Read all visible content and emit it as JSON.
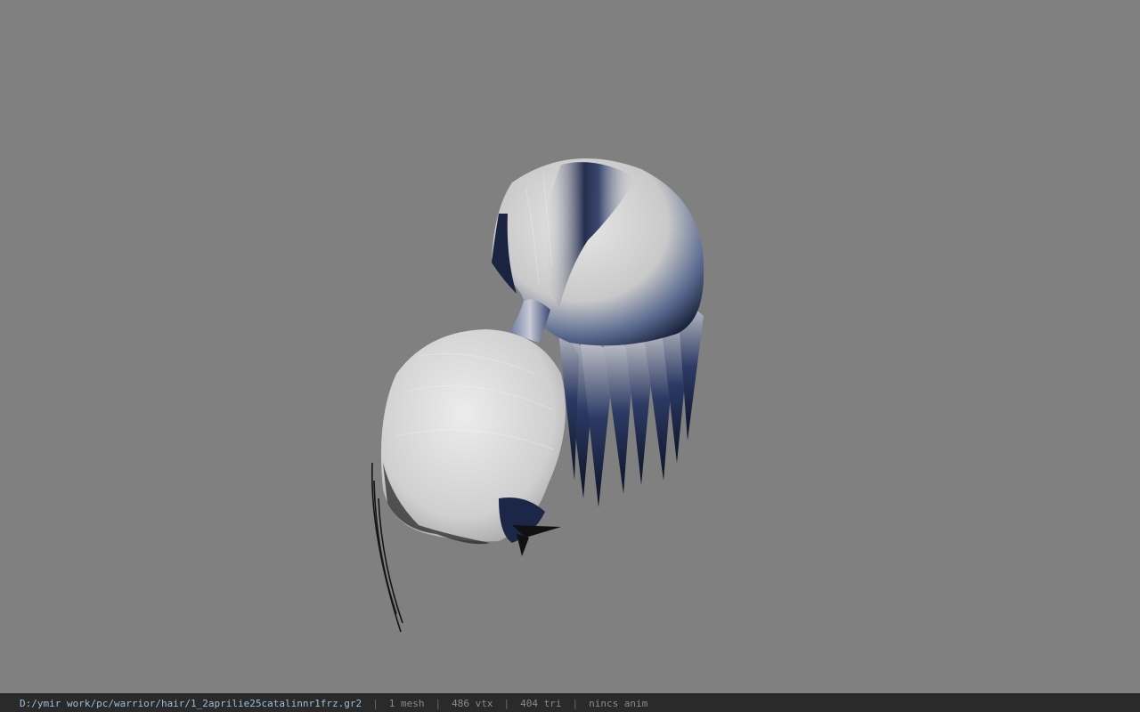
{
  "status": {
    "file_path": "D:/ymir work/pc/warrior/hair/1_2aprilie25catalinnr1frz.gr2",
    "separator": "|",
    "mesh_count": "1 mesh",
    "vertex_count": "486 vtx",
    "triangle_count": "404 tri",
    "animation": "nincs anim"
  },
  "colors": {
    "background": "#808080",
    "hair_base": "#d9d9d9",
    "hair_dark": "#1e2a4a",
    "statusbar_bg": "#2a2a2a",
    "path_text": "#9bbfd6"
  }
}
